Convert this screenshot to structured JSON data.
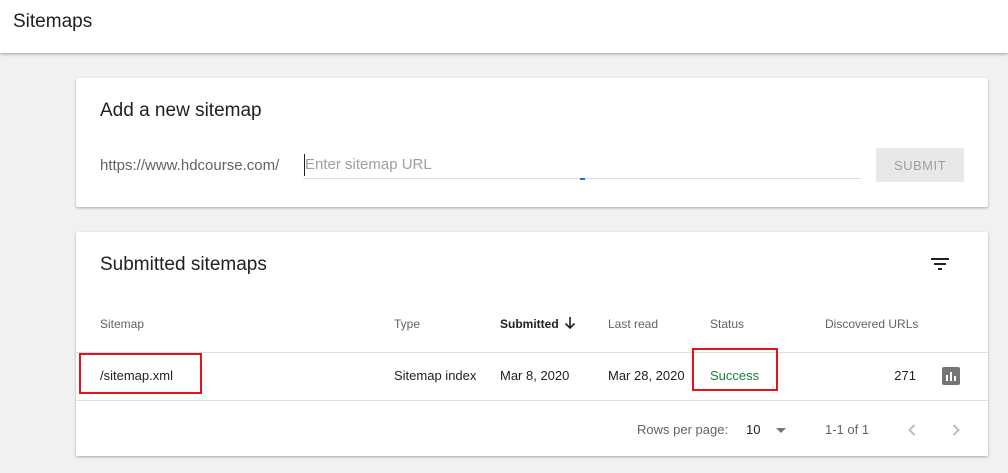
{
  "header": {
    "title": "Sitemaps"
  },
  "add_card": {
    "title": "Add a new sitemap",
    "url_prefix": "https://www.hdcourse.com/",
    "input_value": "",
    "input_placeholder": "Enter sitemap URL",
    "submit_label": "SUBMIT"
  },
  "list_card": {
    "title": "Submitted sitemaps",
    "columns": {
      "sitemap": "Sitemap",
      "type": "Type",
      "submitted": "Submitted",
      "last_read": "Last read",
      "status": "Status",
      "discovered": "Discovered URLs"
    },
    "rows": [
      {
        "sitemap": "/sitemap.xml",
        "type": "Sitemap index",
        "submitted": "Mar 8, 2020",
        "last_read": "Mar 28, 2020",
        "status": "Success",
        "discovered": "271"
      }
    ],
    "footer": {
      "rows_per_page_label": "Rows per page:",
      "rows_per_page_value": "10",
      "range": "1-1 of 1"
    }
  },
  "icons": {
    "filter": "filter-icon",
    "sort": "arrow-down-icon",
    "chart": "bar-chart-icon",
    "prev": "chevron-left-icon",
    "next": "chevron-right-icon"
  },
  "colors": {
    "status_success": "#188038",
    "annotation_box": "#e8101c",
    "focus_underline": "#1a73e8"
  }
}
